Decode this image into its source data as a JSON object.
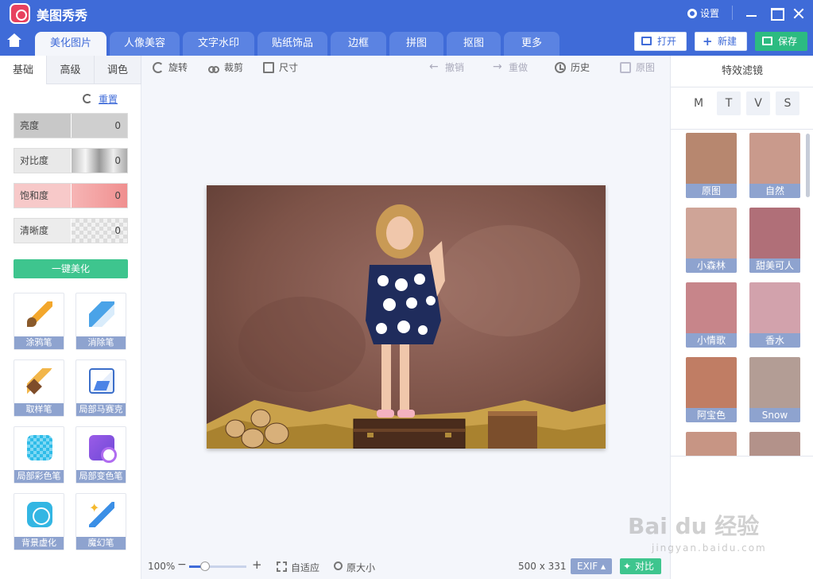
{
  "app": {
    "title": "美图秀秀",
    "settings_label": "设置"
  },
  "tabs": [
    {
      "label": "美化图片"
    },
    {
      "label": "人像美容"
    },
    {
      "label": "文字水印"
    },
    {
      "label": "贴纸饰品"
    },
    {
      "label": "边框"
    },
    {
      "label": "拼图"
    },
    {
      "label": "抠图"
    },
    {
      "label": "更多"
    }
  ],
  "top_actions": {
    "open": "打开",
    "new": "新建",
    "save": "保存"
  },
  "left": {
    "tabs": [
      "基础",
      "高级",
      "调色"
    ],
    "reset_label": "重置",
    "sliders": [
      {
        "label": "亮度",
        "value": "0"
      },
      {
        "label": "对比度",
        "value": "0"
      },
      {
        "label": "饱和度",
        "value": "0"
      },
      {
        "label": "清晰度",
        "value": "0"
      }
    ],
    "one_click": "一键美化",
    "tools": [
      "涂鸦笔",
      "消除笔",
      "取样笔",
      "局部马赛克",
      "局部彩色笔",
      "局部变色笔",
      "背景虚化",
      "魔幻笔"
    ]
  },
  "center": {
    "toolbar": {
      "rotate": "旋转",
      "crop": "裁剪",
      "size": "尺寸",
      "undo": "撤销",
      "redo": "重做",
      "history": "历史",
      "original": "原图"
    },
    "zoom": "100%",
    "zoom_level": 0.28,
    "fit": "自适应",
    "actual_size": "原大小",
    "dimensions": "500 x 331",
    "exif": "EXIF",
    "exif_caret": "▴",
    "compare": "对比"
  },
  "right": {
    "title": "特效滤镜",
    "categories": [
      "M",
      "T",
      "V",
      "S"
    ],
    "filters": [
      "原图",
      "自然",
      "小森林",
      "甜美可人",
      "小情歌",
      "香水",
      "阿宝色",
      "Snow"
    ]
  },
  "watermark": {
    "main": "Bai du 经验",
    "sub": "jingyan.baidu.com"
  },
  "colors": {
    "brand_blue": "#3f6bd8",
    "save_green": "#2cbb81",
    "accent_green": "#3ec58e",
    "label_blue": "#8ea3cf"
  }
}
